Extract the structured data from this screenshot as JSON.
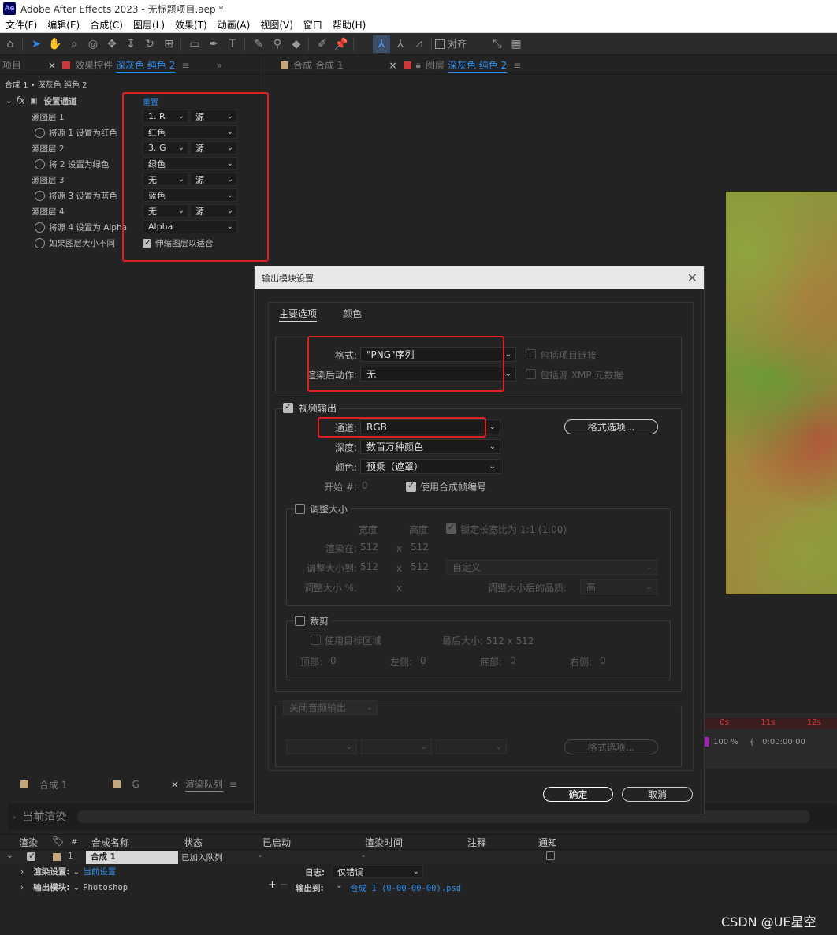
{
  "app": {
    "title": "Adobe After Effects 2023 - 无标题项目.aep *",
    "logo": "Ae",
    "menu": [
      "文件(F)",
      "编辑(E)",
      "合成(C)",
      "图层(L)",
      "效果(T)",
      "动画(A)",
      "视图(V)",
      "窗口",
      "帮助(H)"
    ],
    "toolbar_snap_label": "对齐"
  },
  "left_panel": {
    "tab_project": "项目",
    "tab_effects_prefix": "效果控件",
    "tab_effects_layer": "深灰色 纯色 2",
    "breadcrumb": "合成 1 • 深灰色 纯色 2",
    "effect_name": "设置通道",
    "reset_label": "重置",
    "rows": [
      {
        "label": "源图层 1",
        "layer": "1. R",
        "src": "源"
      },
      {
        "label": "将源 1 设置为红色",
        "value": "红色"
      },
      {
        "label": "源图层 2",
        "layer": "3. G",
        "src": "源"
      },
      {
        "label": "将 2 设置为绿色",
        "value": "绿色"
      },
      {
        "label": "源图层 3",
        "layer": "无",
        "src": "源"
      },
      {
        "label": "将源 3 设置为蓝色",
        "value": "蓝色"
      },
      {
        "label": "源图层 4",
        "layer": "无",
        "src": "源"
      },
      {
        "label": "将源 4 设置为 Alpha",
        "value": "Alpha"
      },
      {
        "label": "如果图层大小不同",
        "check_label": "伸缩图层以适合"
      }
    ]
  },
  "viewer_tabs": {
    "comp_tab_prefix": "合成",
    "comp_tab_name": "合成 1",
    "layer_tab_prefix": "图层",
    "layer_tab_name": "深灰色 纯色 2"
  },
  "dialog": {
    "title": "输出模块设置",
    "tabs": [
      "主要选项",
      "颜色"
    ],
    "format_label": "格式:",
    "format_value": "\"PNG\"序列",
    "post_render_label": "渲染后动作:",
    "post_render_value": "无",
    "include_project_link": "包括项目链接",
    "include_xmp": "包括源 XMP 元数据",
    "video_output": "视频输出",
    "channel_label": "通道:",
    "channel_value": "RGB",
    "format_options": "格式选项...",
    "depth_label": "深度:",
    "depth_value": "数百万种颜色",
    "color_label": "颜色:",
    "color_value": "预乘（遮罩）",
    "start_label": "开始 #:",
    "start_value": "0",
    "use_comp_frame": "使用合成帧编号",
    "resize": {
      "title": "调整大小",
      "width_hdr": "宽度",
      "height_hdr": "高度",
      "lock_aspect": "锁定长宽比为 1:1 (1.00)",
      "render_at_label": "渲染在:",
      "render_w": "512",
      "render_h": "512",
      "resize_to_label": "调整大小到:",
      "resize_w": "512",
      "resize_h": "512",
      "preset": "自定义",
      "percent_label": "调整大小 %:",
      "x": "x",
      "quality_label": "调整大小后的品质:",
      "quality_value": "高"
    },
    "crop": {
      "title": "裁剪",
      "use_roi": "使用目标区域",
      "final_size": "最后大小: 512 x 512",
      "top": "顶部:",
      "top_v": "0",
      "left": "左侧:",
      "left_v": "0",
      "bottom": "底部:",
      "bottom_v": "0",
      "right": "右侧:",
      "right_v": "0"
    },
    "audio_label": "关闭音频输出",
    "audio_format_options": "格式选项...",
    "ok": "确定",
    "cancel": "取消"
  },
  "timeline": {
    "ticks": [
      "0s",
      "11s",
      "12s"
    ],
    "zoom": "100 %",
    "timecode": "0:00:00:00"
  },
  "bottom": {
    "tabs": [
      "合成 1",
      "G",
      "渲染队列"
    ],
    "current_render": "当前渲染",
    "headers": [
      "渲染",
      "#",
      "合成名称",
      "状态",
      "已启动",
      "渲染时间",
      "注释",
      "通知"
    ],
    "row": {
      "num": "1",
      "comp": "合成 1",
      "status": "已加入队列",
      "started": "-",
      "time": "-"
    },
    "render_settings_label": "渲染设置:",
    "render_settings_value": "当前设置",
    "log_label": "日志:",
    "log_value": "仅错误",
    "output_module_label": "输出模块:",
    "output_module_value": "Photoshop",
    "output_to_label": "输出到:",
    "output_to_value": "合成 1 (0-00-00-00).psd"
  },
  "watermark": "CSDN @UE星空",
  "colors": {
    "accent_blue": "#2d8ceb",
    "highlight_red": "#e02020"
  }
}
